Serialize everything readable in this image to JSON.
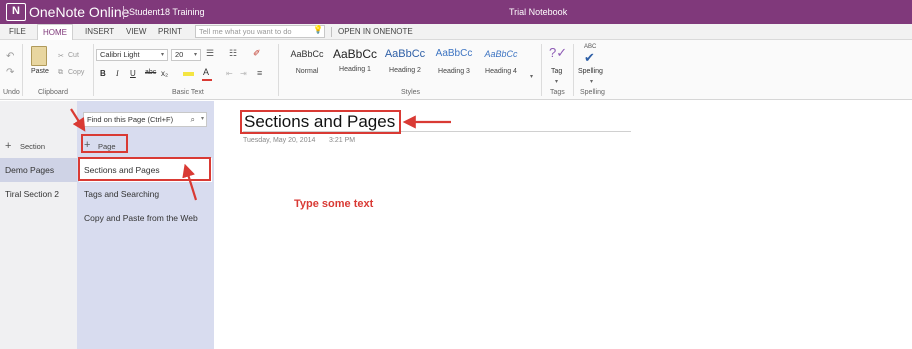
{
  "titlebar": {
    "logo_letter": "N",
    "app_name": "OneNote Online",
    "user": "Student18 Training",
    "notebook": "Trial Notebook"
  },
  "tabs": {
    "file": "FILE",
    "home": "HOME",
    "insert": "INSERT",
    "view": "VIEW",
    "print": "PRINT",
    "tell_me_placeholder": "Tell me what you want to do",
    "open_in_onenote": "OPEN IN ONENOTE"
  },
  "ribbon": {
    "undo_group": "Undo",
    "clipboard_group": "Clipboard",
    "paste": "Paste",
    "cut": "Cut",
    "copy": "Copy",
    "font_name": "Calibri Light",
    "font_size": "20",
    "basic_text_group": "Basic Text",
    "bold": "B",
    "italic": "I",
    "underline": "U",
    "strikethrough": "abc",
    "subscript": "x₂",
    "styles_group": "Styles",
    "styles": [
      {
        "sample": "AaBbCc",
        "name": "Normal"
      },
      {
        "sample": "AaBbCc",
        "name": "Heading 1"
      },
      {
        "sample": "AaBbCc",
        "name": "Heading 2"
      },
      {
        "sample": "AaBbCc",
        "name": "Heading 3"
      },
      {
        "sample": "AaBbCc",
        "name": "Heading 4"
      }
    ],
    "tag": "Tag",
    "tags_group": "Tags",
    "spelling_abc": "ABC",
    "spelling": "Spelling",
    "spelling_group": "Spelling"
  },
  "sections": {
    "add_section": "Section",
    "items": [
      "Demo Pages",
      "Tiral Section 2"
    ]
  },
  "pages": {
    "find_placeholder": "Find on this Page (Ctrl+F)",
    "add_page": "Page",
    "items": [
      "Sections and Pages",
      "Tags and Searching",
      "Copy and Paste from the Web"
    ]
  },
  "page": {
    "title": "Sections and Pages",
    "date": "Tuesday, May 20, 2014",
    "time": "3:21 PM",
    "annotation_text": "Type some text"
  },
  "colors": {
    "brand": "#80397b",
    "annotation": "#d93a34",
    "page_pane": "#d8dcef"
  }
}
